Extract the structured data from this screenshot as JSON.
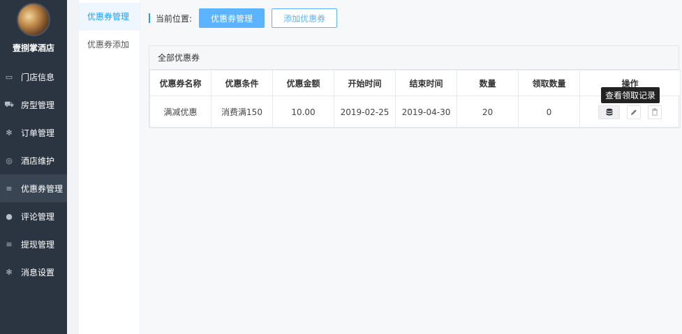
{
  "brand": {
    "name": "壹捌掌酒店"
  },
  "nav": [
    {
      "label": "门店信息",
      "icon": "store-card-icon",
      "glyph": "▭"
    },
    {
      "label": "房型管理",
      "icon": "cart-icon",
      "glyph": "⛟"
    },
    {
      "label": "订单管理",
      "icon": "gear-icon",
      "glyph": "✻"
    },
    {
      "label": "酒店维护",
      "icon": "compass-icon",
      "glyph": "◎"
    },
    {
      "label": "优惠券管理",
      "icon": "menu-icon",
      "glyph": "≡"
    },
    {
      "label": "评论管理",
      "icon": "user-icon",
      "glyph": "●"
    },
    {
      "label": "提现管理",
      "icon": "list-icon",
      "glyph": "≡"
    },
    {
      "label": "消息设置",
      "icon": "settings-icon",
      "glyph": "✻"
    }
  ],
  "submenu": {
    "items": [
      "优惠券管理",
      "优惠券添加"
    ]
  },
  "crumb": {
    "label": "当前位置:",
    "current": "优惠券管理",
    "add": "添加优惠券"
  },
  "panel": {
    "title": "全部优惠券"
  },
  "table": {
    "headers": [
      "优惠券名称",
      "优惠条件",
      "优惠金额",
      "开始时间",
      "结束时间",
      "数量",
      "领取数量",
      "操作"
    ],
    "rows": [
      {
        "name": "满减优惠",
        "condition": "消费满150",
        "amount": "10.00",
        "start": "2019-02-25",
        "end": "2019-04-30",
        "qty": "20",
        "claimed": "0"
      }
    ]
  },
  "tooltip": "查看领取记录",
  "colors": {
    "sidebar": "#2b3441",
    "accent": "#1e9fff",
    "button": "#5cb3ff"
  }
}
